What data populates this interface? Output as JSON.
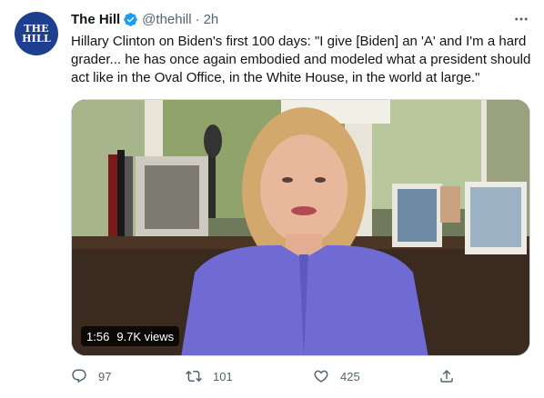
{
  "account": {
    "avatar_line1": "THE",
    "avatar_line2": "HILL",
    "name": "The Hill",
    "handle": "@thehill",
    "separator": "·",
    "time": "2h"
  },
  "tweet": {
    "text": "Hillary Clinton on Biden's first 100 days: \"I give [Biden] an 'A' and I'm a hard grader... he has once again embodied and modeled what a president should act like in the Oval Office, in the White House, in the world at large.\""
  },
  "video": {
    "duration": "1:56",
    "views": "9.7K views"
  },
  "actions": {
    "replies": "97",
    "retweets": "101",
    "likes": "425"
  },
  "icons": {
    "verified": "verified-badge-icon",
    "more": "more-options-icon",
    "reply": "reply-icon",
    "retweet": "retweet-icon",
    "like": "heart-icon",
    "share": "share-icon"
  },
  "colors": {
    "avatar_bg": "#1d3f90",
    "verified": "#1d9bf0",
    "muted_text": "#536471",
    "primary_text": "#0f1419"
  }
}
